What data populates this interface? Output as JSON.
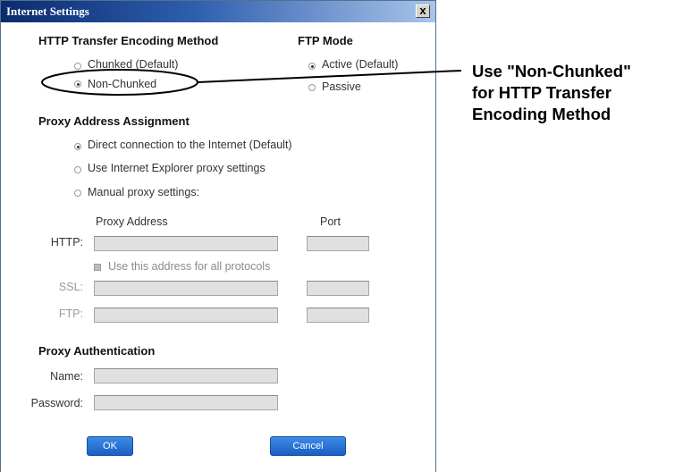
{
  "window": {
    "title": "Internet Settings",
    "close_label": "x"
  },
  "http_section": {
    "heading": "HTTP Transfer Encoding Method",
    "options": [
      "Chunked (Default)",
      "Non-Chunked"
    ],
    "selected": "Non-Chunked"
  },
  "ftp_section": {
    "heading": "FTP Mode",
    "options": [
      "Active (Default)",
      "Passive"
    ],
    "selected": "Active (Default)"
  },
  "proxy_section": {
    "heading": "Proxy Address Assignment",
    "options": [
      "Direct connection to the Internet  (Default)",
      "Use Internet Explorer proxy settings",
      "Manual proxy settings:"
    ],
    "selected": "Direct connection to the Internet  (Default)",
    "col_address": "Proxy Address",
    "col_port": "Port",
    "http_label": "HTTP:",
    "same_address_label": "Use this address for all protocols",
    "ssl_label": "SSL:",
    "ftp_label": "FTP:",
    "http_address": "",
    "http_port": "",
    "ssl_address": "",
    "ssl_port": "",
    "ftp_address": "",
    "ftp_port": ""
  },
  "auth_section": {
    "heading": "Proxy Authentication",
    "name_label": "Name:",
    "password_label": "Password:",
    "name_value": "",
    "password_value": ""
  },
  "buttons": {
    "ok": "OK",
    "cancel": "Cancel"
  },
  "callout": {
    "lines": [
      "Use \"Non-Chunked\"",
      "for HTTP Transfer",
      "Encoding Method"
    ]
  },
  "colors": {
    "title_bar": "#0a2b6e",
    "button": "#1b5fc4",
    "disabled_field": "#e1e0de"
  }
}
